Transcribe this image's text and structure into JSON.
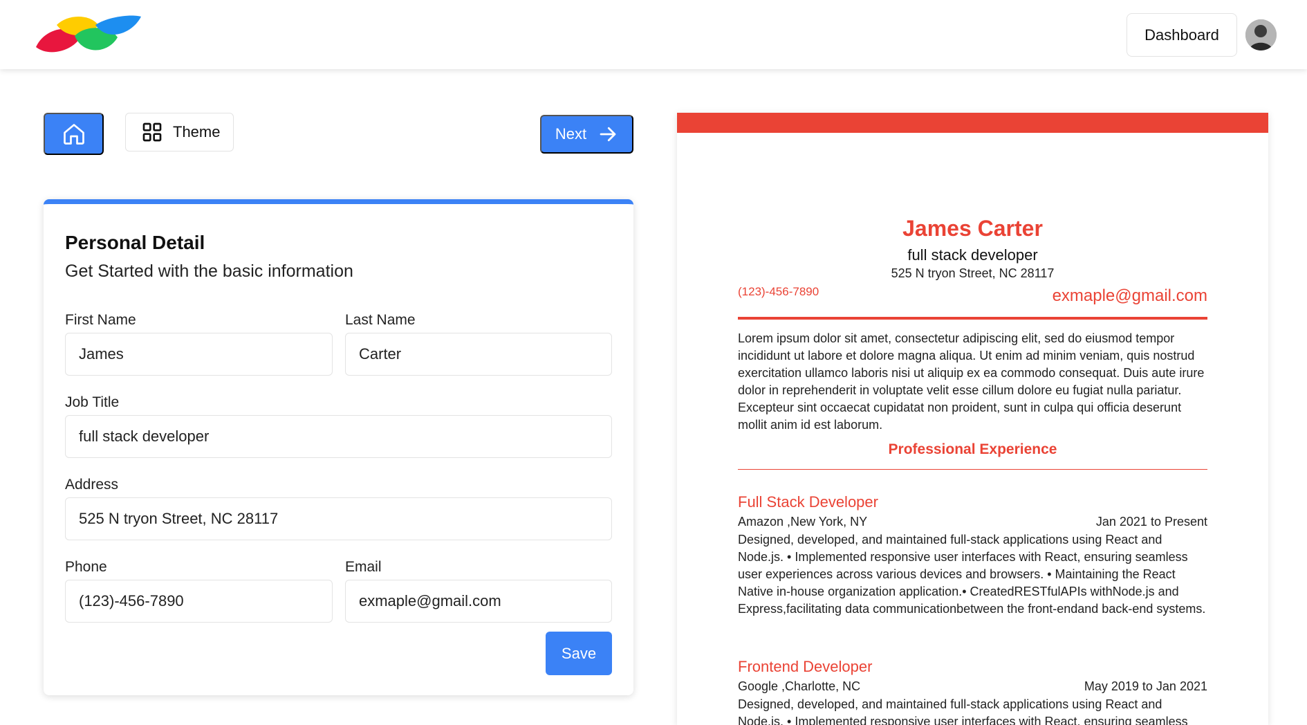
{
  "header": {
    "dashboard_label": "Dashboard",
    "brand_colors": [
      "#e8163e",
      "#ffcc00",
      "#22c55e",
      "#1d8ef0"
    ]
  },
  "toolbar": {
    "home_icon": "home-icon",
    "theme_label": "Theme",
    "theme_icon": "grid-icon",
    "next_label": "Next",
    "next_icon": "arrow-right-icon"
  },
  "form": {
    "title": "Personal Detail",
    "subtitle": "Get Started with the basic information",
    "first_name": {
      "label": "First Name",
      "value": "James"
    },
    "last_name": {
      "label": "Last Name",
      "value": "Carter"
    },
    "job_title": {
      "label": "Job Title",
      "value": "full stack developer"
    },
    "address": {
      "label": "Address",
      "value": "525 N tryon Street, NC 28117"
    },
    "phone": {
      "label": "Phone",
      "value": "(123)-456-7890"
    },
    "email": {
      "label": "Email",
      "value": "exmaple@gmail.com"
    },
    "save_label": "Save"
  },
  "resume": {
    "theme_color": "#ea4335",
    "name": "James Carter",
    "job_title": "full stack developer",
    "address": "525 N tryon Street, NC 28117",
    "phone": "(123)-456-7890",
    "email": "exmaple@gmail.com",
    "summary": "Lorem ipsum dolor sit amet, consectetur adipiscing elit, sed do eiusmod tempor incididunt ut labore et dolore magna aliqua. Ut enim ad minim veniam, quis nostrud exercitation ullamco laboris nisi ut aliquip ex ea commodo consequat. Duis aute irure dolor in reprehenderit in voluptate velit esse cillum dolore eu fugiat nulla pariatur. Excepteur sint occaecat cupidatat non proident, sunt in culpa qui officia deserunt mollit anim id est laborum.",
    "experience_heading": "Professional Experience",
    "experience": [
      {
        "title": "Full Stack Developer",
        "company": "Amazon ,New York, NY",
        "dates": "Jan 2021 to Present",
        "description": "Designed, developed, and maintained full-stack applications using React and Node.js. • Implemented responsive user interfaces with React, ensuring seamless user experiences across various devices and browsers. • Maintaining the React Native in-house organization application.• CreatedRESTfulAPIs withNode.js and Express,facilitating data communicationbetween the front-endand back-end systems."
      },
      {
        "title": "Frontend Developer",
        "company": "Google ,Charlotte, NC",
        "dates": "May 2019 to Jan 2021",
        "description": "Designed, developed, and maintained full-stack applications using React and Node.js. • Implemented responsive user interfaces with React, ensuring seamless user experiences across various devices and browsers."
      }
    ]
  }
}
